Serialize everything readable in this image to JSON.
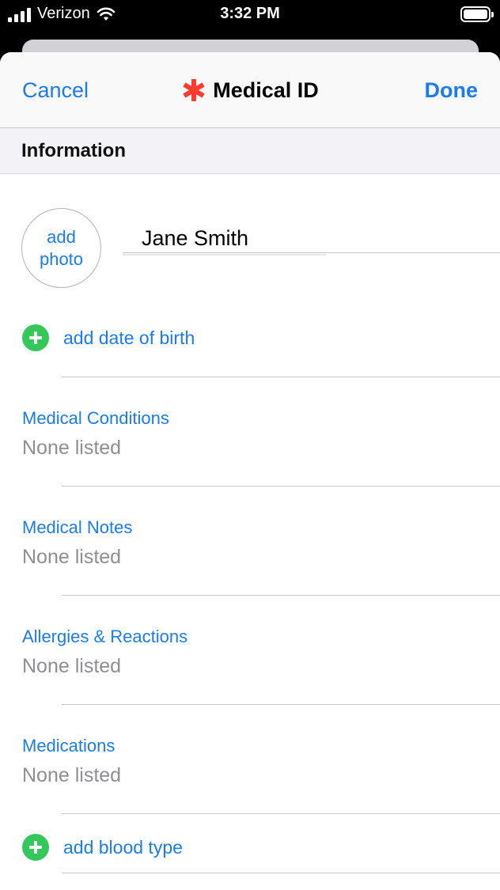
{
  "status_bar": {
    "carrier": "Verizon",
    "time": "3:32 PM",
    "battery_level": 1.0
  },
  "navbar": {
    "cancel_label": "Cancel",
    "title": "Medical ID",
    "done_label": "Done",
    "accent_color": "#1a7cf0",
    "asterisk_color": "#ff3b30"
  },
  "section": {
    "title": "Information"
  },
  "profile": {
    "photo_label": "add photo",
    "name": "Jane Smith"
  },
  "add_date_of_birth": "add date of birth",
  "fields": [
    {
      "title": "Medical Conditions",
      "value": "None listed"
    },
    {
      "title": "Medical Notes",
      "value": "None listed"
    },
    {
      "title": "Allergies & Reactions",
      "value": "None listed"
    },
    {
      "title": "Medications",
      "value": "None listed"
    }
  ],
  "add_blood_type": "add blood type"
}
